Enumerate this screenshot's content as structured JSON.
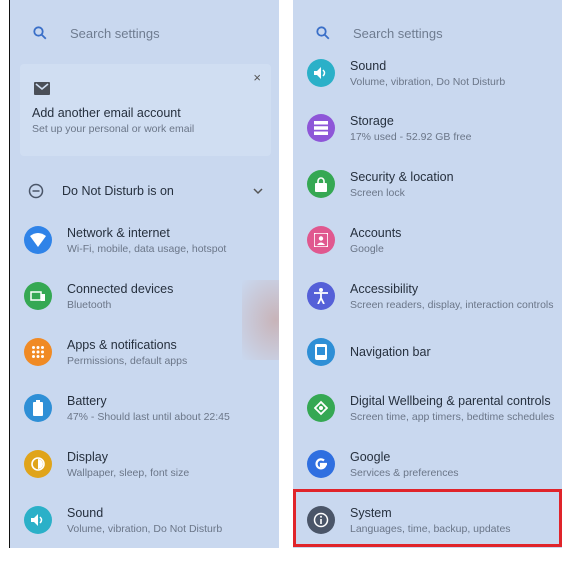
{
  "search": {
    "placeholder": "Search settings"
  },
  "suggestion_card": {
    "title": "Add another email account",
    "subtitle": "Set up your personal or work email",
    "close": "×"
  },
  "dnd": {
    "label": "Do Not Disturb is on"
  },
  "left_items": [
    {
      "title": "Network & internet",
      "subtitle": "Wi-Fi, mobile, data usage, hotspot",
      "color": "#2f83e8",
      "icon": "wifi-icon"
    },
    {
      "title": "Connected devices",
      "subtitle": "Bluetooth",
      "color": "#35a853",
      "icon": "devices-icon"
    },
    {
      "title": "Apps & notifications",
      "subtitle": "Permissions, default apps",
      "color": "#f08a24",
      "icon": "apps-grid-icon"
    },
    {
      "title": "Battery",
      "subtitle": "47% - Should last until about 22:45",
      "color": "#2e8fd6",
      "icon": "battery-icon"
    },
    {
      "title": "Display",
      "subtitle": "Wallpaper, sleep, font size",
      "color": "#e0a41a",
      "icon": "brightness-icon"
    },
    {
      "title": "Sound",
      "subtitle": "Volume, vibration, Do Not Disturb",
      "color": "#2bb0c8",
      "icon": "volume-icon"
    }
  ],
  "right_items": [
    {
      "title": "Sound",
      "subtitle": "Volume, vibration, Do Not Disturb",
      "color": "#2bb0c8",
      "icon": "volume-icon"
    },
    {
      "title": "Storage",
      "subtitle": "17% used - 52.92 GB free",
      "color": "#8e56d8",
      "icon": "storage-icon"
    },
    {
      "title": "Security & location",
      "subtitle": "Screen lock",
      "color": "#35a853",
      "icon": "lock-icon"
    },
    {
      "title": "Accounts",
      "subtitle": "Google",
      "color": "#e0588f",
      "icon": "account-icon"
    },
    {
      "title": "Accessibility",
      "subtitle": "Screen readers, display, interaction controls",
      "color": "#5560d8",
      "icon": "accessibility-icon"
    },
    {
      "title": "Navigation bar",
      "subtitle": "",
      "color": "#2e8fd6",
      "icon": "navigation-icon"
    },
    {
      "title": "Digital Wellbeing & parental controls",
      "subtitle": "Screen time, app timers, bedtime schedules",
      "color": "#35a853",
      "icon": "wellbeing-icon"
    },
    {
      "title": "Google",
      "subtitle": "Services & preferences",
      "color": "#2f6fe0",
      "icon": "google-icon"
    },
    {
      "title": "System",
      "subtitle": "Languages, time, backup, updates",
      "color": "#4a5568",
      "icon": "info-icon"
    }
  ]
}
